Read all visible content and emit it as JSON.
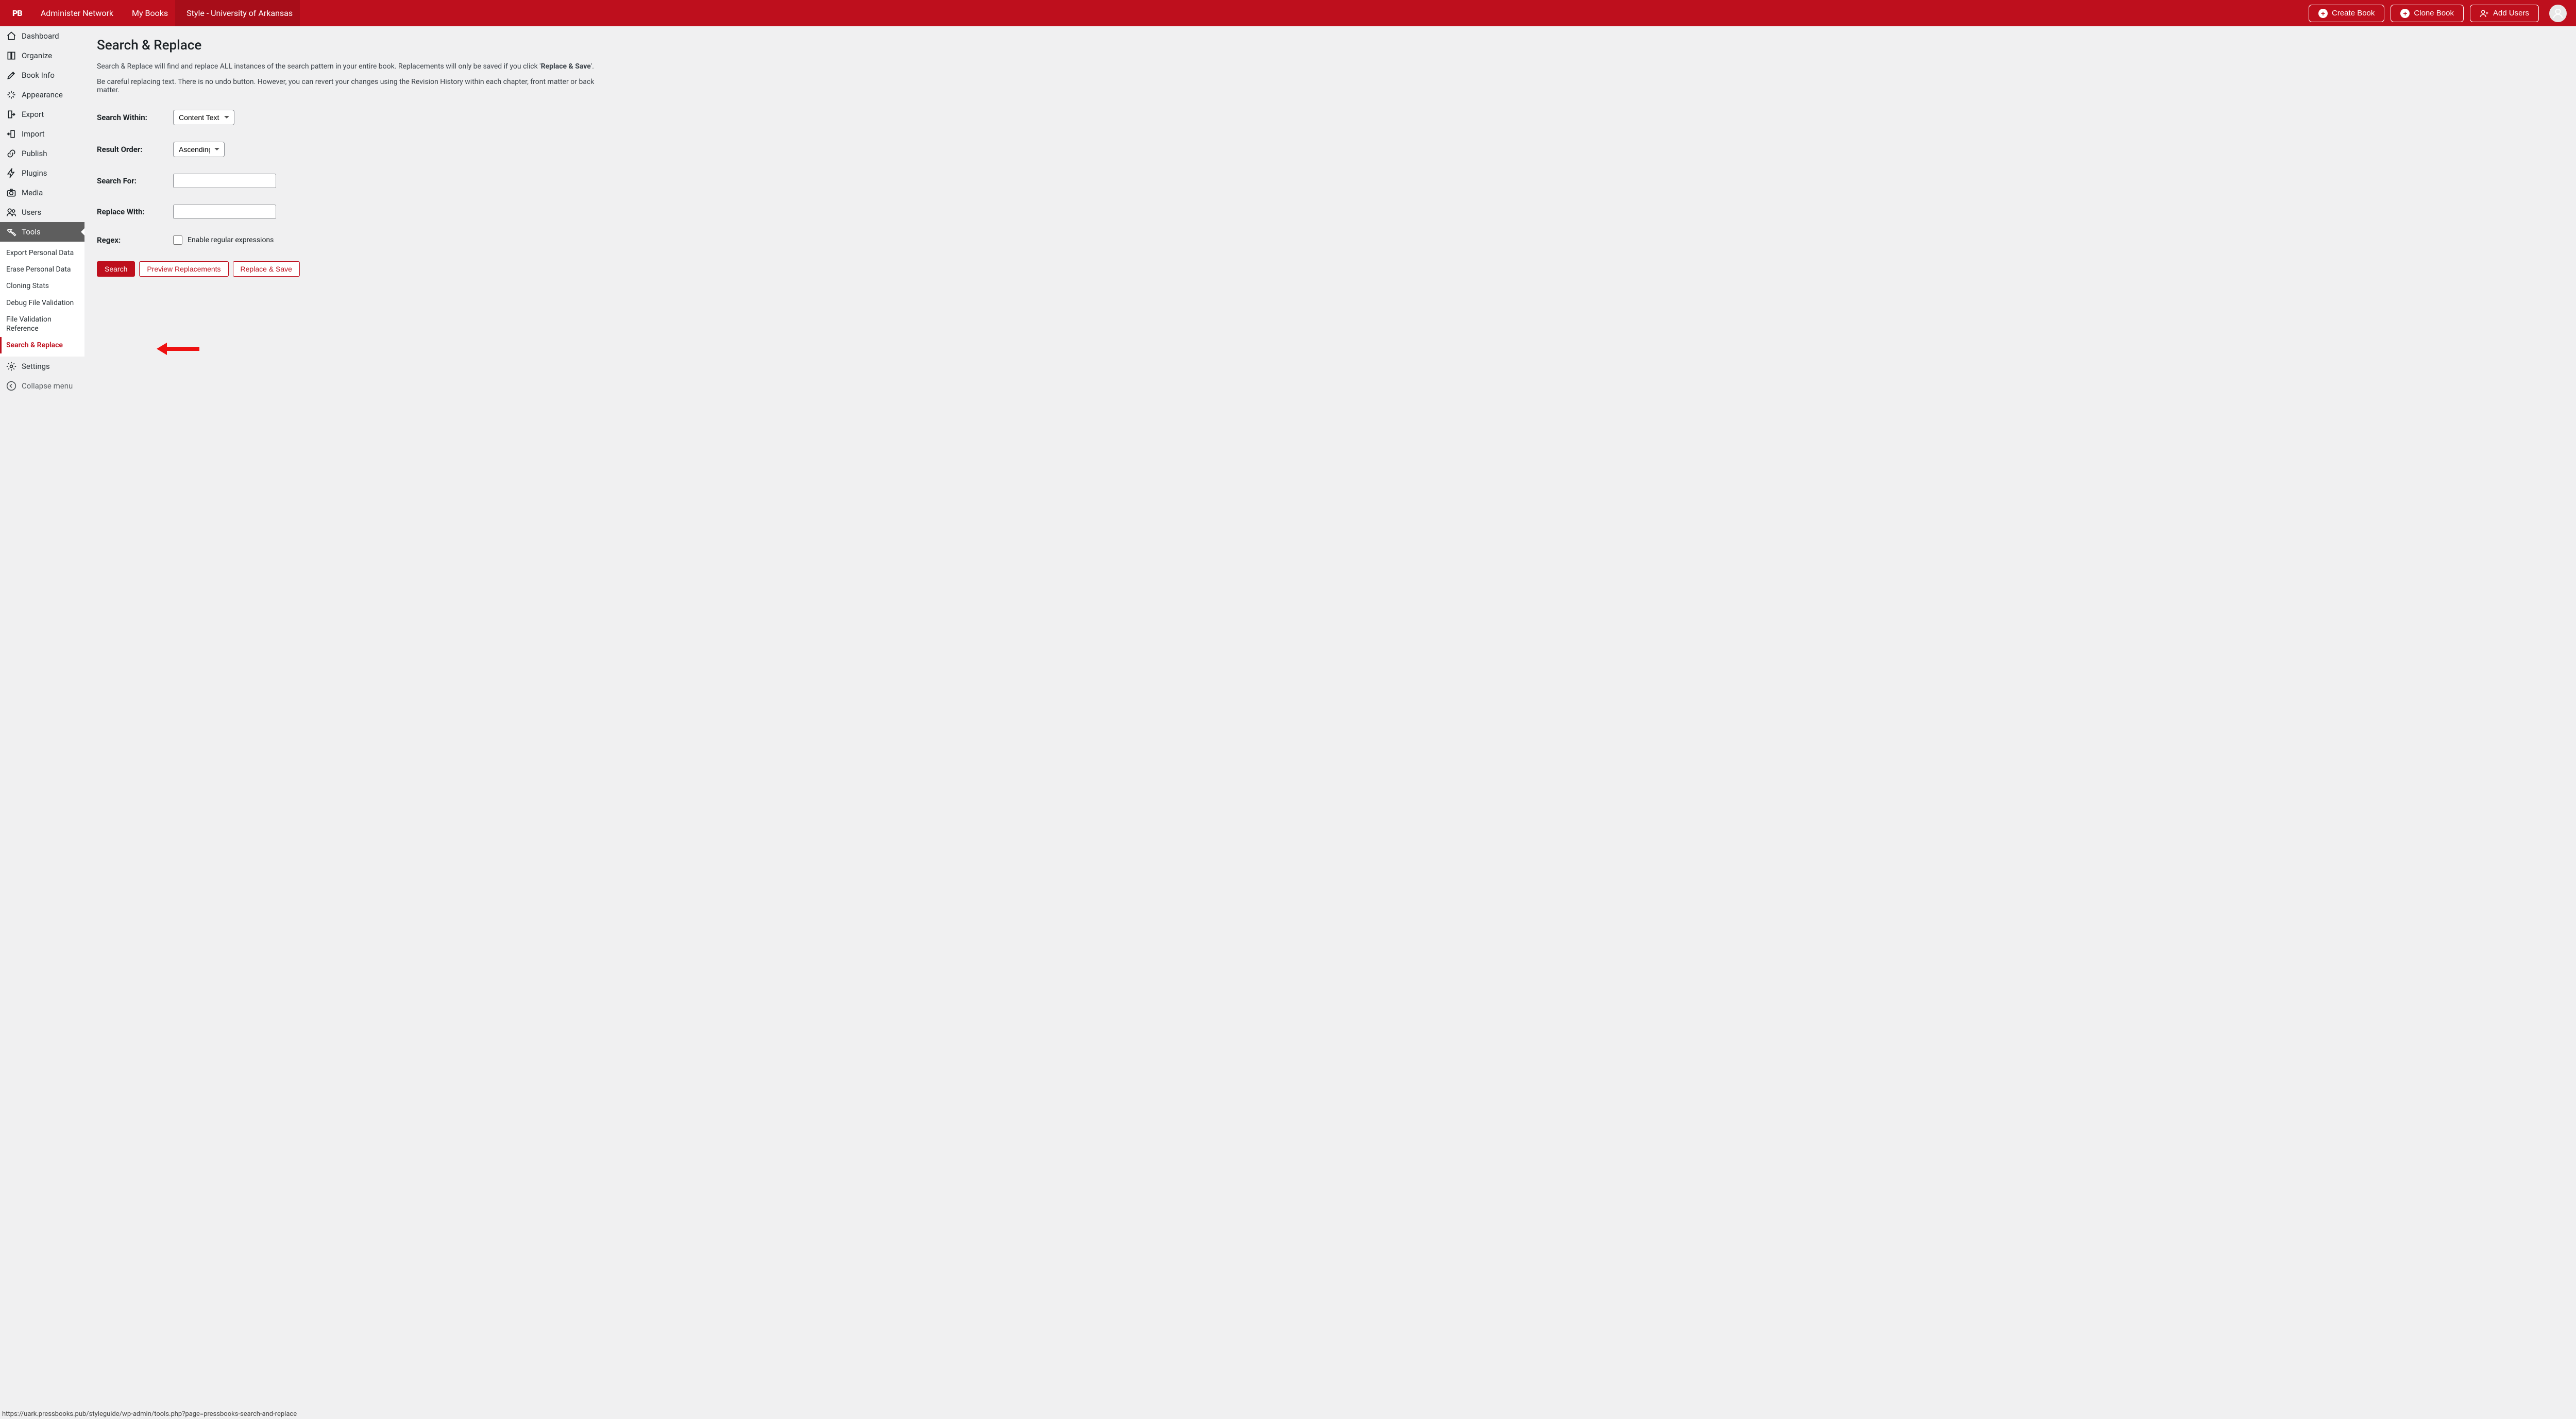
{
  "topbar": {
    "logo": "PB",
    "admin_network": "Administer Network",
    "my_books": "My Books",
    "book_title": "Style - University of Arkansas",
    "create_book": "Create Book",
    "clone_book": "Clone Book",
    "add_users": "Add Users"
  },
  "sidebar": {
    "dashboard": "Dashboard",
    "organize": "Organize",
    "book_info": "Book Info",
    "appearance": "Appearance",
    "export": "Export",
    "import": "Import",
    "publish": "Publish",
    "plugins": "Plugins",
    "media": "Media",
    "users": "Users",
    "tools": "Tools",
    "submenu": {
      "export_personal_data": "Export Personal Data",
      "erase_personal_data": "Erase Personal Data",
      "cloning_stats": "Cloning Stats",
      "debug_file_validation": "Debug File Validation",
      "file_validation_reference": "File Validation Reference",
      "search_replace": "Search & Replace"
    },
    "settings": "Settings",
    "collapse": "Collapse menu"
  },
  "page": {
    "title": "Search & Replace",
    "desc1a": "Search & Replace will find and replace ALL instances of the search pattern in your entire book. Replacements will only be saved if you click '",
    "desc1b": "Replace & Save",
    "desc1c": "'.",
    "desc2": "Be careful replacing text. There is no undo button. However, you can revert your changes using the Revision History within each chapter, front matter or back matter.",
    "labels": {
      "search_within": "Search Within:",
      "result_order": "Result Order:",
      "search_for": "Search For:",
      "replace_with": "Replace With:",
      "regex": "Regex:"
    },
    "values": {
      "search_within": "Content Text",
      "result_order": "Ascending",
      "search_for": "",
      "replace_with": "",
      "enable_regex_label": "Enable regular expressions"
    },
    "buttons": {
      "search": "Search",
      "preview": "Preview Replacements",
      "replace_save": "Replace & Save"
    }
  },
  "status_bar": "https://uark.pressbooks.pub/styleguide/wp-admin/tools.php?page=pressbooks-search-and-replace"
}
